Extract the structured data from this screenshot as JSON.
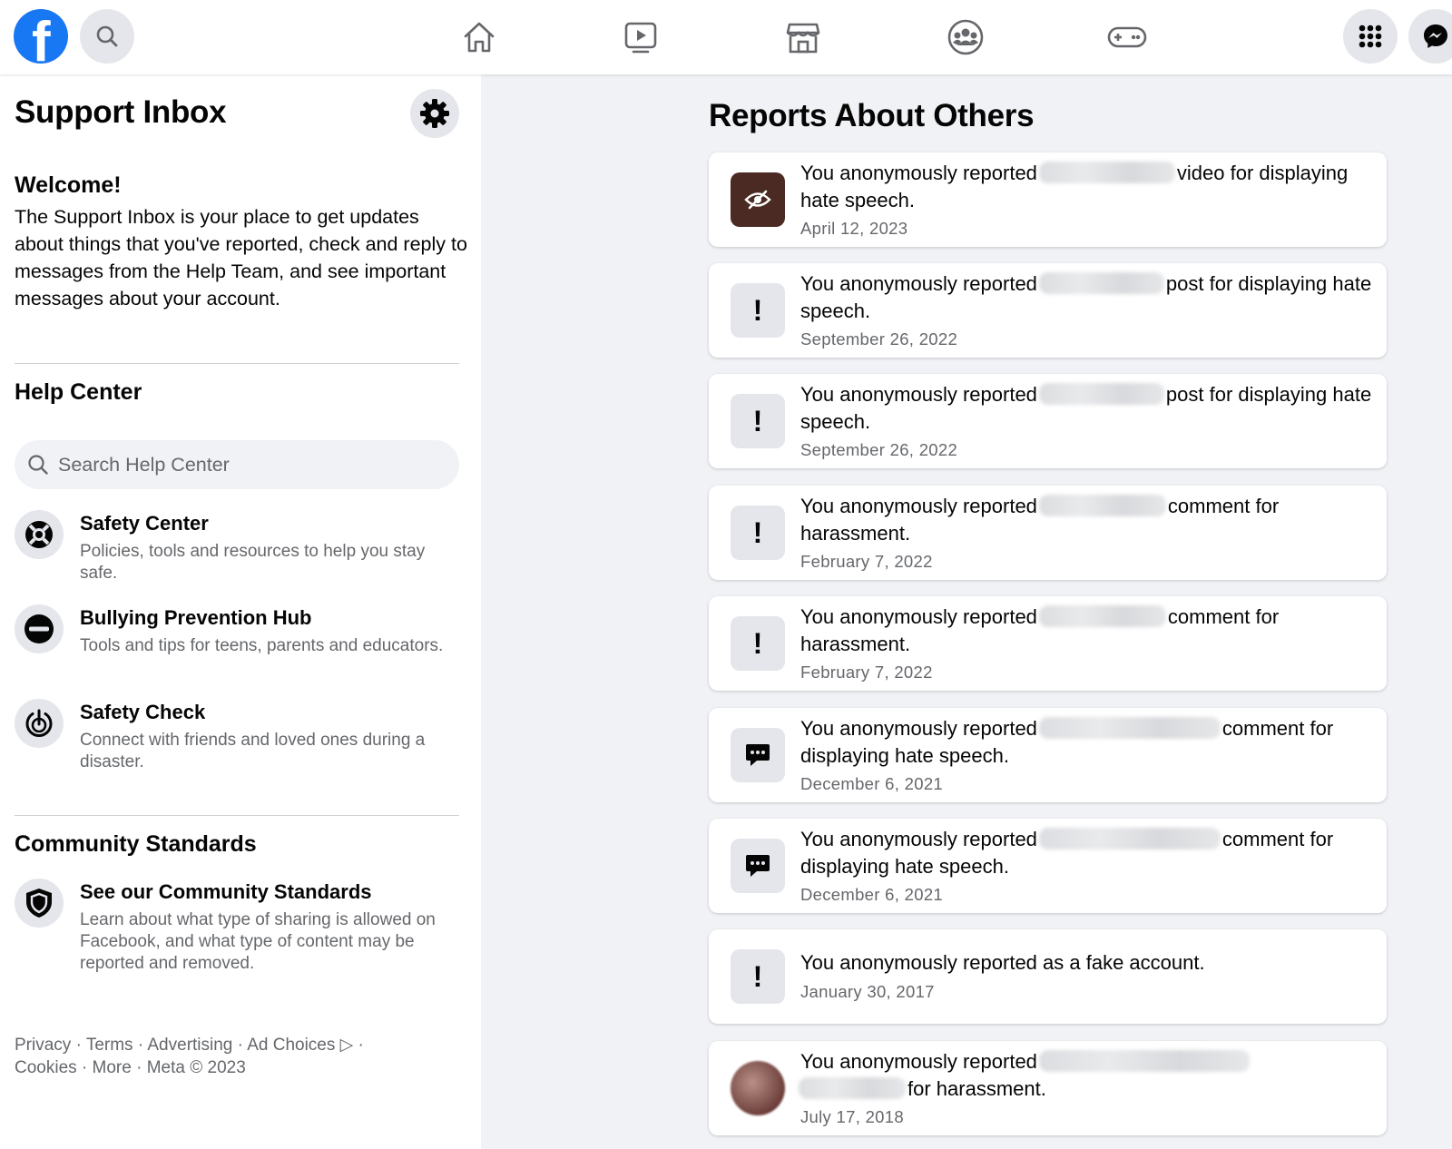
{
  "topbar": {
    "logo": "f",
    "icons": [
      "facebook-logo",
      "search-icon",
      "home-icon",
      "watch-icon",
      "marketplace-icon",
      "groups-icon",
      "gaming-icon",
      "menu-grid-icon",
      "messenger-icon"
    ]
  },
  "left": {
    "title": "Support Inbox",
    "welcome_title": "Welcome!",
    "welcome_text": "The Support Inbox is your place to get updates about things that you've reported, check and reply to messages from the Help Team, and see important messages about your account.",
    "help_center": {
      "title": "Help Center",
      "search_placeholder": "Search Help Center",
      "items": [
        {
          "title": "Safety Center",
          "desc": "Policies, tools and resources to help you stay safe.",
          "icon": "lifebuoy-icon"
        },
        {
          "title": "Bullying Prevention Hub",
          "desc": "Tools and tips for teens, parents and educators.",
          "icon": "no-entry-icon"
        },
        {
          "title": "Safety Check",
          "desc": "Connect with friends and loved ones during a disaster.",
          "icon": "safety-check-icon"
        }
      ]
    },
    "community": {
      "title": "Community Standards",
      "items": [
        {
          "title": "See our Community Standards",
          "desc": "Learn about what type of sharing is allowed on Facebook, and what type of content may be reported and removed.",
          "icon": "shield-icon"
        }
      ]
    },
    "footer": {
      "line1": "Privacy · Terms · Advertising · Ad Choices ▷ ·",
      "line2": "Cookies · More · Meta © 2023"
    }
  },
  "reports": {
    "title": "Reports About Others",
    "items": [
      {
        "prefix": "You anonymously reported",
        "suffix": "video for displaying hate speech.",
        "date": "April 12, 2023",
        "icon": "hidden-eye-thumbnail"
      },
      {
        "prefix": "You anonymously reported",
        "suffix": "post for displaying hate speech.",
        "date": "September 26, 2022",
        "icon": "exclamation-icon"
      },
      {
        "prefix": "You anonymously reported",
        "suffix": "post for displaying hate speech.",
        "date": "September 26, 2022",
        "icon": "exclamation-icon"
      },
      {
        "prefix": "You anonymously reported",
        "suffix": "comment for harassment.",
        "date": "February 7, 2022",
        "icon": "exclamation-icon"
      },
      {
        "prefix": "You anonymously reported",
        "suffix": "comment for harassment.",
        "date": "February 7, 2022",
        "icon": "exclamation-icon"
      },
      {
        "prefix": "You anonymously reported",
        "suffix": "comment for displaying hate speech.",
        "date": "December 6, 2021",
        "icon": "comment-bubble-icon"
      },
      {
        "prefix": "You anonymously reported",
        "suffix": "comment for displaying hate speech.",
        "date": "December 6, 2021",
        "icon": "comment-bubble-icon"
      },
      {
        "text": "You anonymously reported as a fake account.",
        "date": "January 30, 2017",
        "icon": "exclamation-icon"
      },
      {
        "prefix": "You anonymously reported",
        "suffix": "for harassment.",
        "date": "July 17, 2018",
        "icon": "profile-avatar"
      }
    ]
  },
  "colors": {
    "brand": "#1877f2",
    "secondary_text": "#65676b",
    "background": "#f0f2f5"
  }
}
